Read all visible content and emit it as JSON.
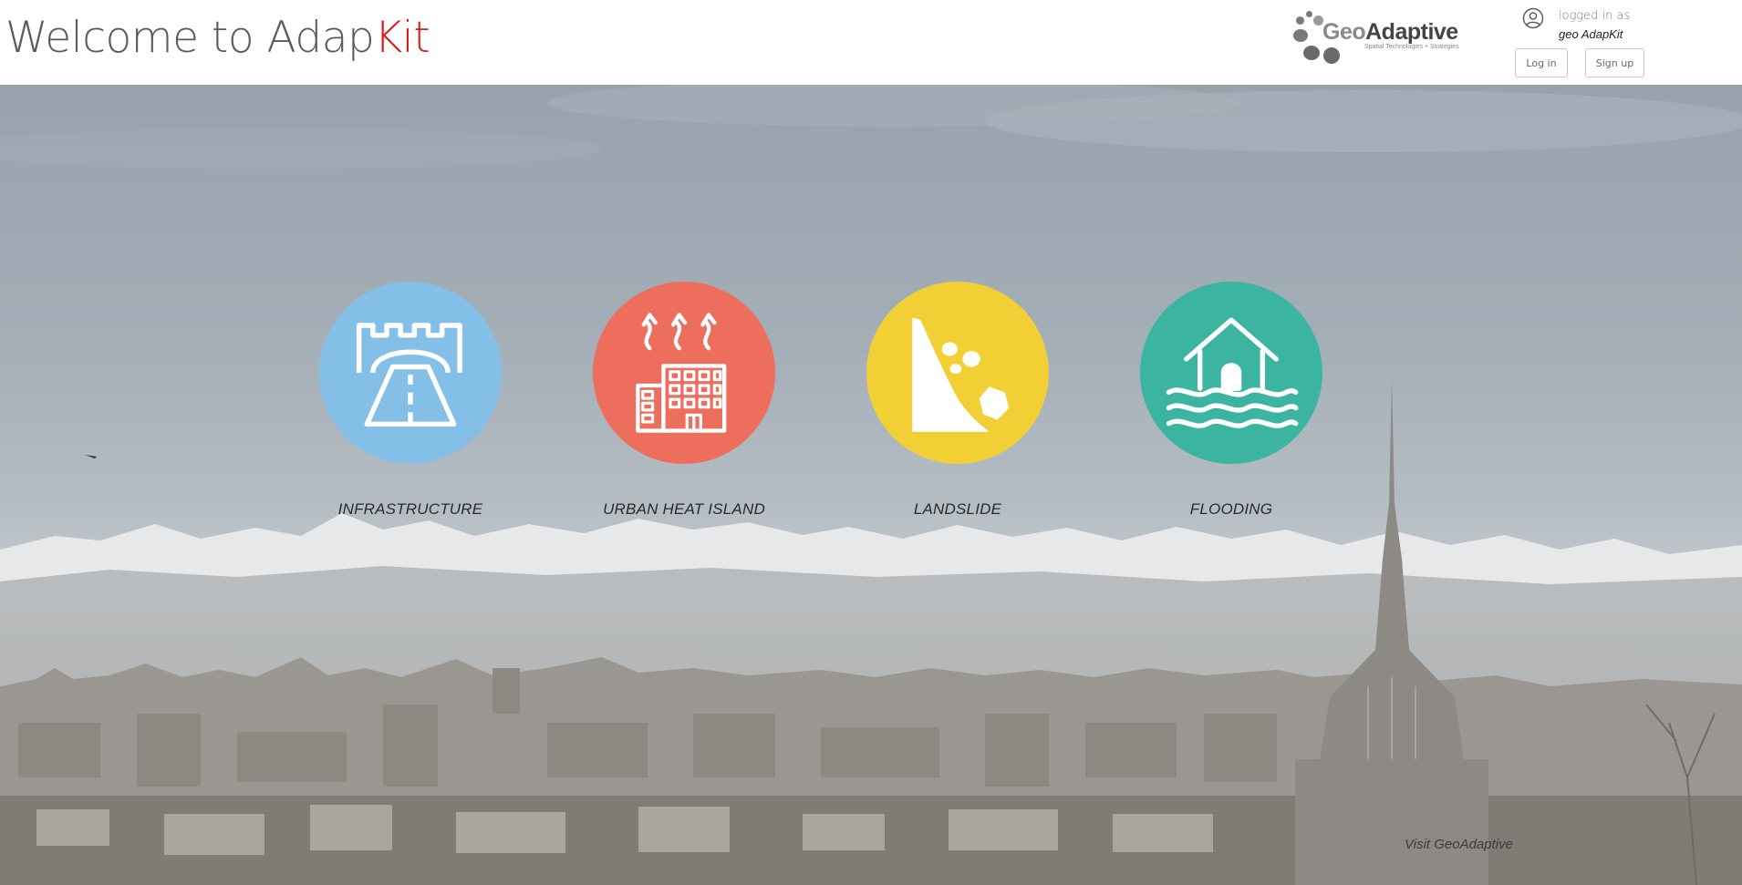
{
  "header": {
    "title_prefix": "Welcome to Adap",
    "title_accent": "Kit",
    "brand": {
      "name_light": "Geo",
      "name_bold": "Adaptive",
      "tagline": "Spatial Technologies + Strategies"
    },
    "user": {
      "logged_label": "logged in as",
      "name": "geo AdapKit"
    },
    "login_label": "Log in",
    "signup_label": "Sign up"
  },
  "categories": [
    {
      "label": "INFRASTRUCTURE",
      "color": "#84bfe8",
      "icon": "road-tunnel-icon"
    },
    {
      "label": "URBAN HEAT ISLAND",
      "color": "#ee6e5e",
      "icon": "building-heat-icon"
    },
    {
      "label": "LANDSLIDE",
      "color": "#f3cf36",
      "icon": "landslide-icon"
    },
    {
      "label": "FLOODING",
      "color": "#3cb5a0",
      "icon": "flooded-house-icon"
    }
  ],
  "footer": {
    "visit_label": "Visit GeoAdaptive"
  },
  "colors": {
    "accent": "#d61f1f"
  }
}
